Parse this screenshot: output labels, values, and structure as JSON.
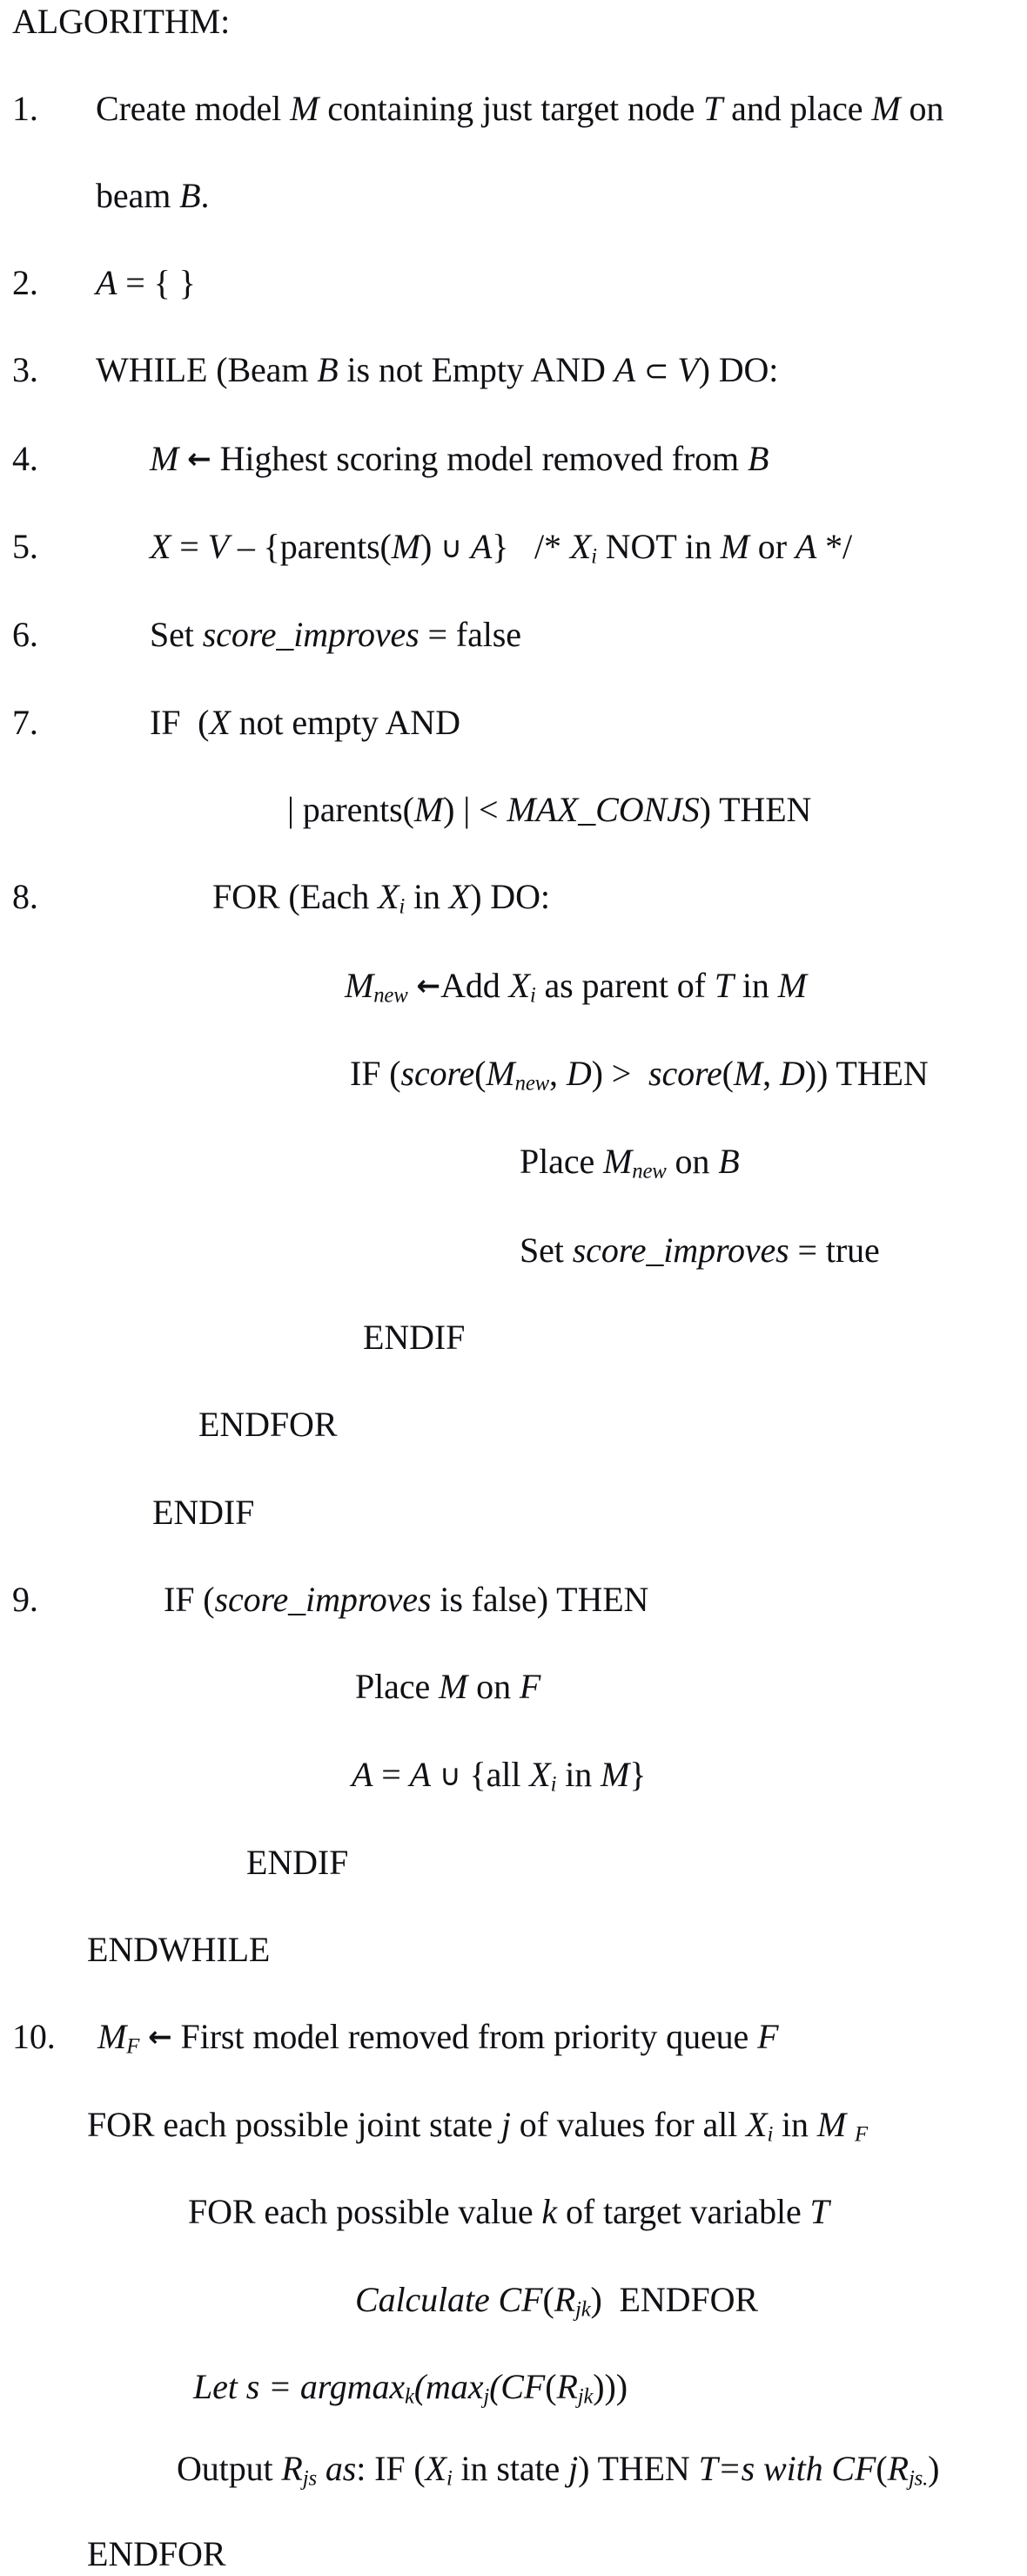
{
  "document": {
    "title": "ALGORITHM:",
    "background_color": "#ffffff",
    "text_color": "#101015"
  },
  "lines": [
    {
      "num": "",
      "segments": [
        {
          "t": "ALGORITHM:",
          "s": "plain"
        }
      ],
      "indent": 14
    },
    {
      "num": "1.",
      "segments": [
        {
          "t": "Create model ",
          "s": "plain"
        },
        {
          "t": "M",
          "s": "italic"
        },
        {
          "t": " containing just target node ",
          "s": "plain"
        },
        {
          "t": "T",
          "s": "italic"
        },
        {
          "t": " and place ",
          "s": "plain"
        },
        {
          "t": "M",
          "s": "italic"
        },
        {
          "t": " on",
          "s": "plain"
        }
      ],
      "indent": 110
    },
    {
      "num": "",
      "segments": [
        {
          "t": "beam ",
          "s": "plain"
        },
        {
          "t": "B",
          "s": "italic"
        },
        {
          "t": ".",
          "s": "plain"
        }
      ],
      "indent": 110
    },
    {
      "num": "2.",
      "segments": [
        {
          "t": "A",
          "s": "italic"
        },
        {
          "t": " = { }",
          "s": "plain"
        }
      ],
      "indent": 110
    },
    {
      "num": "3.",
      "segments": [
        {
          "t": "WHILE (Beam ",
          "s": "plain"
        },
        {
          "t": "B",
          "s": "italic"
        },
        {
          "t": " is not Empty AND ",
          "s": "plain"
        },
        {
          "t": "A",
          "s": "italic"
        },
        {
          "t": " ⊂ ",
          "s": "op"
        },
        {
          "t": "V",
          "s": "italic"
        },
        {
          "t": ") DO:",
          "s": "plain"
        }
      ],
      "indent": 110
    },
    {
      "num": "4.",
      "segments": [
        {
          "t": "M",
          "s": "italic"
        },
        {
          "t": " ← ",
          "s": "arrow"
        },
        {
          "t": "Highest scoring model removed from ",
          "s": "plain"
        },
        {
          "t": "B",
          "s": "italic"
        }
      ],
      "indent": 172
    },
    {
      "num": "5.",
      "segments": [
        {
          "t": "X",
          "s": "italic"
        },
        {
          "t": " = ",
          "s": "plain"
        },
        {
          "t": "V",
          "s": "italic"
        },
        {
          "t": " – {parents(",
          "s": "plain"
        },
        {
          "t": "M",
          "s": "italic"
        },
        {
          "t": ")",
          "s": "plain"
        },
        {
          "t": " ∪ ",
          "s": "op"
        },
        {
          "t": "A",
          "s": "italic"
        },
        {
          "t": "}   /* ",
          "s": "plain"
        },
        {
          "t": "X",
          "s": "italic-sub-i"
        },
        {
          "t": " NOT in ",
          "s": "plain"
        },
        {
          "t": "M",
          "s": "italic"
        },
        {
          "t": " or ",
          "s": "plain"
        },
        {
          "t": "A",
          "s": "italic"
        },
        {
          "t": " */",
          "s": "plain"
        }
      ],
      "indent": 172
    },
    {
      "num": "6.",
      "segments": [
        {
          "t": "Set ",
          "s": "plain"
        },
        {
          "t": "score_improves",
          "s": "italic"
        },
        {
          "t": " = false",
          "s": "plain"
        }
      ],
      "indent": 172
    },
    {
      "num": "7.",
      "segments": [
        {
          "t": "IF  (",
          "s": "plain"
        },
        {
          "t": "X",
          "s": "italic"
        },
        {
          "t": " not empty AND",
          "s": "plain"
        }
      ],
      "indent": 172
    },
    {
      "num": "",
      "segments": [
        {
          "t": "| parents(",
          "s": "plain"
        },
        {
          "t": "M",
          "s": "italic"
        },
        {
          "t": ") | < ",
          "s": "plain"
        },
        {
          "t": "MAX_CONJS",
          "s": "italic"
        },
        {
          "t": ") THEN",
          "s": "plain"
        }
      ],
      "indent": 330
    },
    {
      "num": "8.",
      "segments": [
        {
          "t": "FOR (Each ",
          "s": "plain"
        },
        {
          "t": "X",
          "s": "italic-sub-i"
        },
        {
          "t": " in ",
          "s": "plain"
        },
        {
          "t": "X",
          "s": "italic"
        },
        {
          "t": ") DO:",
          "s": "plain"
        }
      ],
      "indent": 244
    },
    {
      "num": "",
      "segments": [
        {
          "t": "M",
          "s": "italic-sub-new"
        },
        {
          "t": " ←",
          "s": "arrow"
        },
        {
          "t": "Add ",
          "s": "plain"
        },
        {
          "t": "X",
          "s": "italic-sub-i"
        },
        {
          "t": " as parent of ",
          "s": "plain"
        },
        {
          "t": "T",
          "s": "italic"
        },
        {
          "t": " in ",
          "s": "plain"
        },
        {
          "t": "M",
          "s": "italic"
        }
      ],
      "indent": 396
    },
    {
      "num": "",
      "segments": [
        {
          "t": "IF (",
          "s": "plain"
        },
        {
          "t": "score",
          "s": "italic"
        },
        {
          "t": "(",
          "s": "italic"
        },
        {
          "t": "M",
          "s": "italic-sub-new"
        },
        {
          "t": ", D",
          "s": "italic"
        },
        {
          "t": ") > ",
          "s": "italic"
        },
        {
          "t": " score",
          "s": "italic"
        },
        {
          "t": "(M, D",
          "s": "italic"
        },
        {
          "t": ")) ",
          "s": "italic"
        },
        {
          "t": "THEN",
          "s": "plain"
        }
      ],
      "indent": 402
    },
    {
      "num": "",
      "segments": [
        {
          "t": "Place ",
          "s": "plain"
        },
        {
          "t": "M",
          "s": "italic-sub-new"
        },
        {
          "t": " on ",
          "s": "plain"
        },
        {
          "t": "B",
          "s": "italic"
        }
      ],
      "indent": 597
    },
    {
      "num": "",
      "segments": [
        {
          "t": "Set ",
          "s": "plain"
        },
        {
          "t": "score_improves",
          "s": "italic"
        },
        {
          "t": " = true",
          "s": "plain"
        }
      ],
      "indent": 597
    },
    {
      "num": "",
      "segments": [
        {
          "t": "ENDIF",
          "s": "plain"
        }
      ],
      "indent": 417
    },
    {
      "num": "",
      "segments": [
        {
          "t": "ENDFOR",
          "s": "plain"
        }
      ],
      "indent": 228
    },
    {
      "num": "",
      "segments": [
        {
          "t": "ENDIF",
          "s": "plain"
        }
      ],
      "indent": 175
    },
    {
      "num": "9.",
      "segments": [
        {
          "t": "IF (",
          "s": "plain"
        },
        {
          "t": "score_improves",
          "s": "italic"
        },
        {
          "t": " is false) THEN",
          "s": "plain"
        }
      ],
      "indent": 188
    },
    {
      "num": "",
      "segments": [
        {
          "t": "Place ",
          "s": "plain"
        },
        {
          "t": "M",
          "s": "italic"
        },
        {
          "t": " on ",
          "s": "plain"
        },
        {
          "t": "F",
          "s": "italic"
        }
      ],
      "indent": 408
    },
    {
      "num": "",
      "segments": [
        {
          "t": "A",
          "s": "italic"
        },
        {
          "t": " = ",
          "s": "plain"
        },
        {
          "t": "A",
          "s": "italic"
        },
        {
          "t": " ∪ ",
          "s": "op"
        },
        {
          "t": "{all ",
          "s": "plain"
        },
        {
          "t": "X",
          "s": "italic-sub-i"
        },
        {
          "t": " in ",
          "s": "plain"
        },
        {
          "t": "M",
          "s": "italic"
        },
        {
          "t": "}",
          "s": "plain"
        }
      ],
      "indent": 404
    },
    {
      "num": "",
      "segments": [
        {
          "t": "ENDIF",
          "s": "plain"
        }
      ],
      "indent": 283
    },
    {
      "num": "",
      "segments": [
        {
          "t": "ENDWHILE",
          "s": "plain"
        }
      ],
      "indent": 100
    },
    {
      "num": "10.",
      "segments": [
        {
          "t": "M",
          "s": "italic-sub-F"
        },
        {
          "t": " ← ",
          "s": "arrow"
        },
        {
          "t": "First model removed from priority queue ",
          "s": "plain"
        },
        {
          "t": "F",
          "s": "italic"
        }
      ],
      "indent": 112
    },
    {
      "num": "",
      "segments": [
        {
          "t": "FOR each possible joint state ",
          "s": "plain"
        },
        {
          "t": "j",
          "s": "italic"
        },
        {
          "t": " of values for all ",
          "s": "plain"
        },
        {
          "t": "X",
          "s": "italic-sub-i"
        },
        {
          "t": " in ",
          "s": "plain"
        },
        {
          "t": "M ",
          "s": "italic-sub-F-spaced"
        }
      ],
      "indent": 100
    },
    {
      "num": "",
      "segments": [
        {
          "t": "FOR each possible value ",
          "s": "plain"
        },
        {
          "t": "k",
          "s": "italic"
        },
        {
          "t": " of target variable ",
          "s": "plain"
        },
        {
          "t": "T",
          "s": "italic"
        }
      ],
      "indent": 216
    },
    {
      "num": "",
      "segments": [
        {
          "t": "Calculate CF(R",
          "s": "italic-sub-jk"
        },
        {
          "t": ")  ",
          "s": "italic"
        },
        {
          "t": "ENDFOR",
          "s": "plain"
        }
      ],
      "indent": 408
    },
    {
      "num": "",
      "segments": [
        {
          "t": "Let s = argmax",
          "s": "italic-sub-k-argmax"
        }
      ],
      "indent": 222
    },
    {
      "num": "",
      "segments": [
        {
          "t": "Output R",
          "s": "italic-output"
        }
      ],
      "indent": 203
    },
    {
      "num": "",
      "segments": [
        {
          "t": "ENDFOR",
          "s": "plain"
        }
      ],
      "indent": 100
    }
  ],
  "raw_text": {
    "line_0": "ALGORITHM:",
    "line_1": "1. Create model M containing just target node T and place M on",
    "line_2": "beam B.",
    "line_3": "2. A = { }",
    "line_4": "3. WHILE (Beam B is not Empty AND A ⊂ V) DO:",
    "line_5": "4. M ← Highest scoring model removed from B",
    "line_6": "5. X = V – {parents(M) ∪ A}   /* Xi NOT in M or A */",
    "line_7": "6. Set score_improves = false",
    "line_8": "7. IF  (X not empty AND",
    "line_9": "| parents(M) | < MAX_CONJS) THEN",
    "line_10": "8. FOR (Each Xi in X) DO:",
    "line_11": "Mnew ←Add Xi as parent of T in M",
    "line_12": "IF (score(Mnew, D) >  score(M, D)) THEN",
    "line_13": "Place Mnew on B",
    "line_14": "Set score_improves = true",
    "line_15": "ENDIF",
    "line_16": "ENDFOR",
    "line_17": "ENDIF",
    "line_18": "9. IF (score_improves is false) THEN",
    "line_19": "Place M on F",
    "line_20": "A = A ∪ {all Xi in M}",
    "line_21": "ENDIF",
    "line_22": "ENDWHILE",
    "line_23": "10. MF ← First model removed from priority queue F",
    "line_24": "FOR each possible joint state j of values for all Xi in M F",
    "line_25": "FOR each possible value k of target variable T",
    "line_26": "Calculate CF(Rjk)  ENDFOR",
    "line_27": "Let s = argmaxk(maxj(CF(Rjk)))",
    "line_28": "Output Rjs as: IF (Xi in state j) THEN T=s with CF(Rjs.)",
    "line_29": "ENDFOR"
  }
}
